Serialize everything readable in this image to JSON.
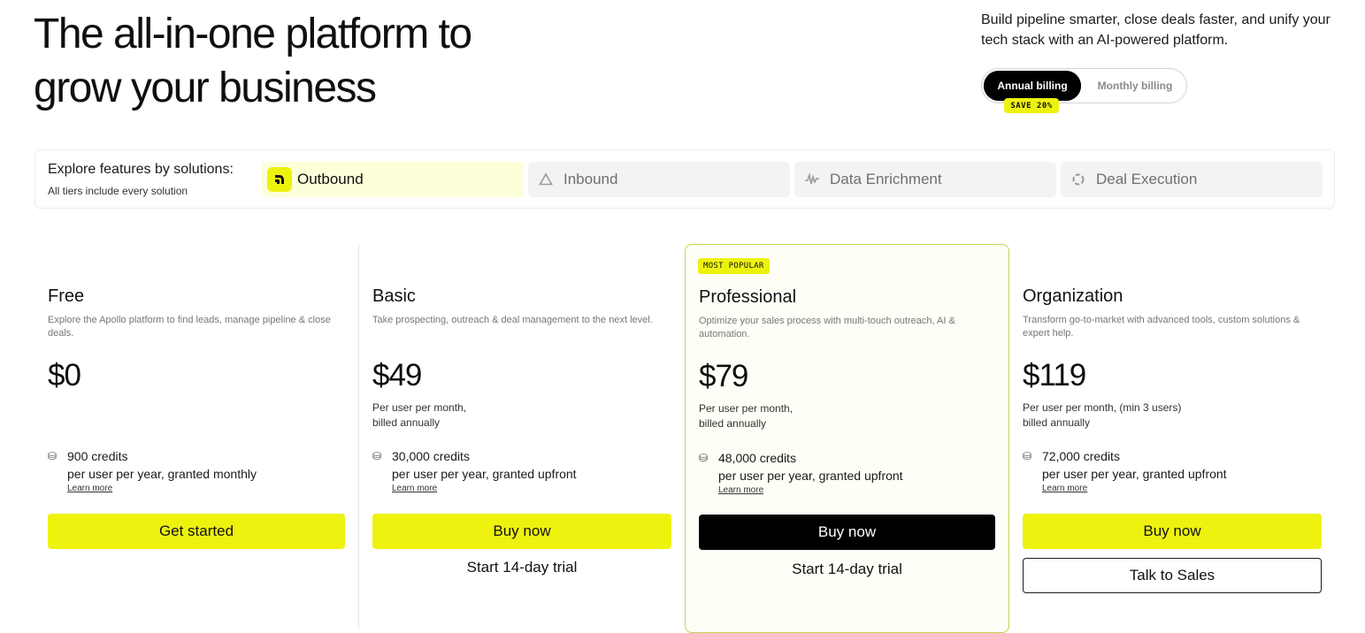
{
  "hero": {
    "title_line1": "The all-in-one platform to",
    "title_line2": "grow your business",
    "subtitle": "Build pipeline smarter, close deals faster, and unify your tech stack with an AI-powered platform."
  },
  "billing": {
    "annual_label": "Annual billing",
    "monthly_label": "Monthly billing",
    "save_badge": "SAVE 20%",
    "selected": "Annual billing"
  },
  "solutions": {
    "title": "Explore features by solutions:",
    "subtitle": "All tiers include every solution",
    "tabs": [
      {
        "label": "Outbound",
        "icon": "outbound-icon",
        "active": true
      },
      {
        "label": "Inbound",
        "icon": "inbound-icon",
        "active": false
      },
      {
        "label": "Data Enrichment",
        "icon": "data-enrichment-icon",
        "active": false
      },
      {
        "label": "Deal Execution",
        "icon": "deal-execution-icon",
        "active": false
      }
    ]
  },
  "plans": [
    {
      "name": "Free",
      "description": "Explore the Apollo platform to find leads, manage pipeline & close deals.",
      "price": "$0",
      "billing_line1": "",
      "billing_line2": "",
      "credits": "900 credits",
      "credits_note": "per user per year, granted monthly",
      "learn_more": "Learn more",
      "primary_cta": "Get started"
    },
    {
      "name": "Basic",
      "description": "Take prospecting, outreach & deal management to the next level.",
      "price": "$49",
      "billing_line1": "Per user per month,",
      "billing_line2": "billed annually",
      "credits": "30,000 credits",
      "credits_note": "per user per year, granted upfront",
      "learn_more": "Learn more",
      "primary_cta": "Buy now",
      "secondary_cta": "Start 14-day trial"
    },
    {
      "badge": "MOST POPULAR",
      "name": "Professional",
      "description": "Optimize your sales process with multi-touch outreach, AI & automation.",
      "price": "$79",
      "billing_line1": "Per user per month,",
      "billing_line2": "billed annually",
      "credits": "48,000 credits",
      "credits_note": "per user per year, granted upfront",
      "learn_more": "Learn more",
      "primary_cta": "Buy now",
      "secondary_cta": "Start 14-day trial"
    },
    {
      "name": "Organization",
      "description": "Transform go-to-market with advanced tools, custom solutions & expert help.",
      "price": "$119",
      "billing_line1": "Per user per month, (min 3 users)",
      "billing_line2": "billed annually",
      "credits": "72,000 credits",
      "credits_note": "per user per year, granted upfront",
      "learn_more": "Learn more",
      "primary_cta": "Buy now",
      "secondary_cta": "Talk to Sales"
    }
  ],
  "colors": {
    "accent_yellow": "#eef20f",
    "popular_border": "#c7d14a",
    "popular_bg": "#fefef6",
    "text_dark": "#0f0f0f"
  }
}
